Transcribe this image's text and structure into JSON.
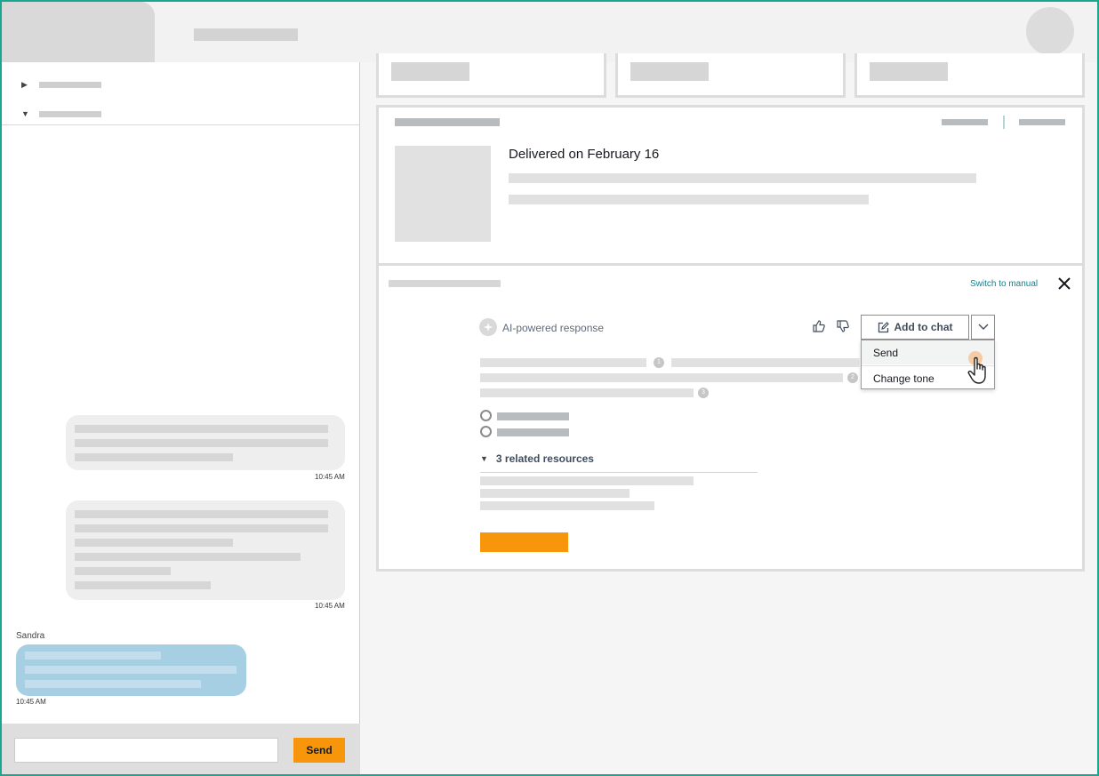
{
  "conversation": {
    "messages": [
      {
        "timestamp": "10:45 AM"
      },
      {
        "timestamp": "10:45 AM"
      },
      {
        "sender": "Sandra",
        "timestamp": "10:45 AM"
      }
    ],
    "compose": {
      "placeholder": "",
      "send_label": "Send"
    }
  },
  "order": {
    "status": "Delivered on February 16"
  },
  "assistant": {
    "switch_label": "Switch to manual",
    "ai_label": "AI-powered response",
    "add_to_chat_label": "Add to chat",
    "menu_items": [
      "Send",
      "Change tone"
    ],
    "citations": [
      "1",
      "2",
      "3"
    ],
    "related_resources_label": "3 related resources"
  },
  "colors": {
    "accent": "#f7960b",
    "frame": "#1aa68f",
    "link": "#137f8c",
    "agent_bubble": "#a7cfe4"
  },
  "icons": [
    "tree-collapsed-icon",
    "tree-expanded-icon",
    "close-icon",
    "ai-sparkle-icon",
    "thumbs-up-icon",
    "thumbs-down-icon",
    "edit-icon",
    "chevron-down-icon",
    "hand-pointer-icon"
  ]
}
